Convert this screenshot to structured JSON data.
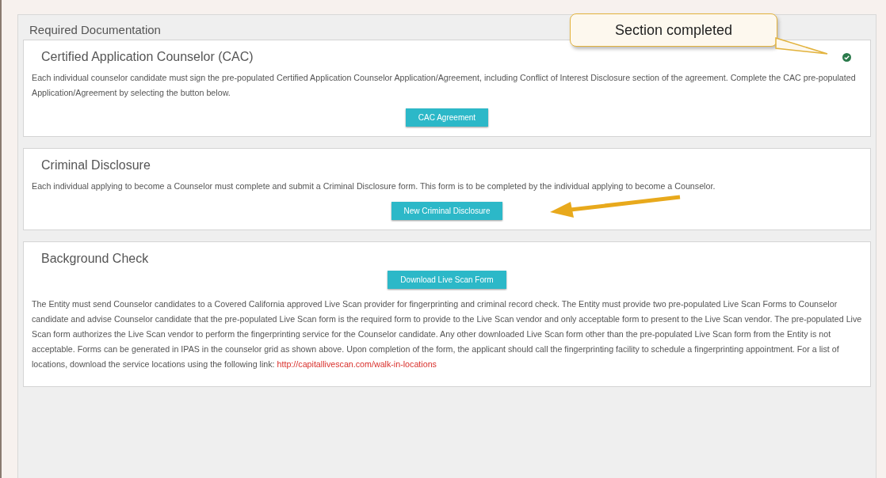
{
  "panel": {
    "title": "Required Documentation"
  },
  "callout": {
    "text": "Section completed"
  },
  "sections": [
    {
      "kind": "prompt",
      "title": "Certified Application Counselor (CAC)",
      "completed": true,
      "text": "Each individual counselor candidate must sign the pre-populated Certified Application Counselor Application/Agreement, including Conflict of Interest Disclosure section of the agreement. Complete the CAC pre-populated Application/Agreement by selecting the button below.",
      "button": "CAC Agreement",
      "highlighted": false
    },
    {
      "kind": "prompt",
      "title": "Criminal Disclosure",
      "completed": false,
      "text": "Each individual applying to become a Counselor must complete and submit a Criminal Disclosure form. This form is to be completed by the individual applying to become a Counselor.",
      "button": "New Criminal Disclosure",
      "highlighted": true
    },
    {
      "kind": "download",
      "title": "Background Check",
      "completed": false,
      "text": "The Entity must send Counselor candidates to a Covered California approved Live Scan provider for fingerprinting and criminal record check. The Entity must provide two pre-populated Live Scan Forms to Counselor candidate and advise Counselor candidate that the pre-populated Live Scan form is the required form to provide to the Live Scan vendor and only acceptable form to present to the Live Scan vendor. The pre-populated Live Scan form authorizes the Live Scan vendor to perform the fingerprinting service for the Counselor candidate. Any other downloaded Live Scan form other than the pre-populated Live Scan form from the Entity is not acceptable. Forms can be generated in IPAS in the counselor grid as shown above. Upon completion of the form, the applicant should call the fingerprinting facility to schedule a fingerprinting appointment. For a list of locations, download the service locations using the following link:",
      "link": "http://capitallivescan.com/walk-in-locations",
      "button": "Download Live Scan Form",
      "highlighted": false
    }
  ]
}
